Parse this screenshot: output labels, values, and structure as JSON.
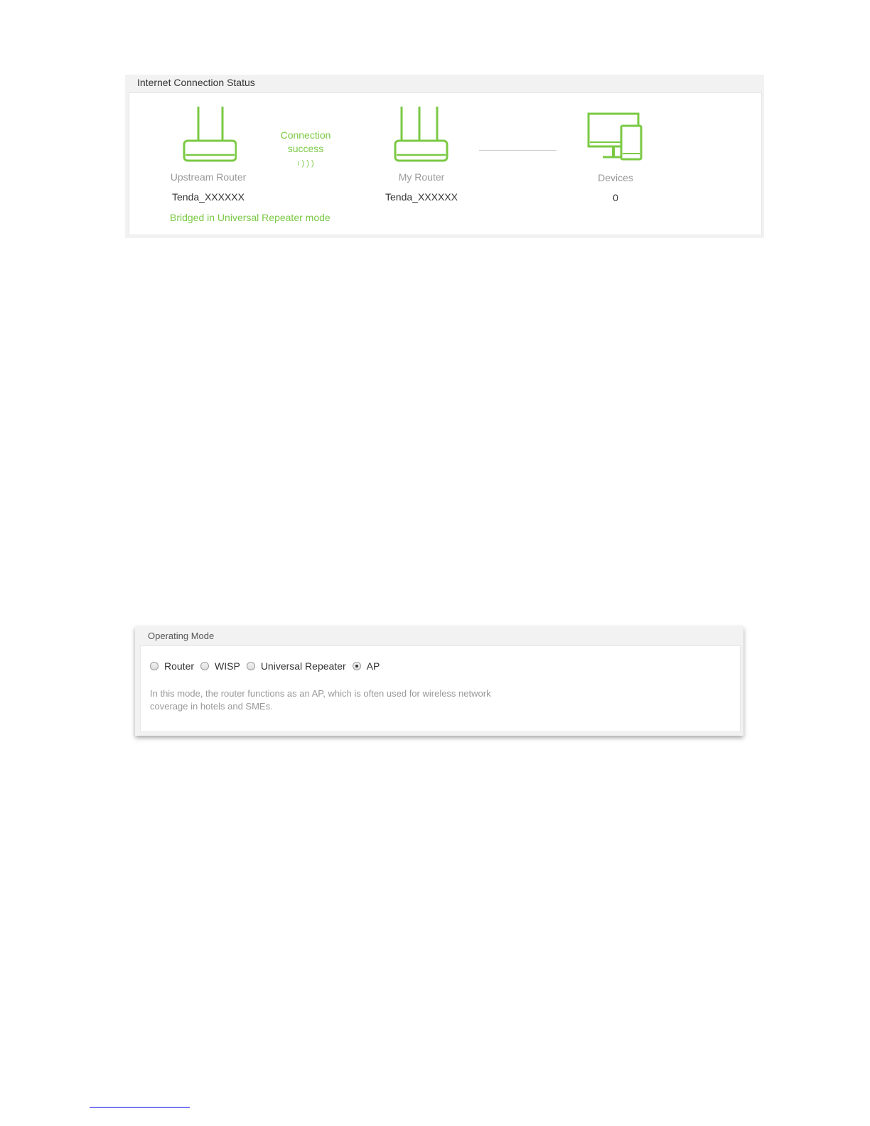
{
  "connection_status": {
    "title": "Internet Connection Status",
    "upstream_router": {
      "label": "Upstream Router",
      "name": "Tenda_XXXXXX",
      "mode_text": "Bridged in Universal Repeater mode"
    },
    "link": {
      "status_line1": "Connection",
      "status_line2": "success",
      "signal_glyph": "ı ) ) )"
    },
    "my_router": {
      "label": "My Router",
      "name": "Tenda_XXXXXX"
    },
    "devices": {
      "label": "Devices",
      "count": "0"
    },
    "colors": {
      "accent": "#7ac943",
      "label": "#999999",
      "text": "#333333"
    }
  },
  "operating_mode": {
    "title": "Operating Mode",
    "options": [
      {
        "label": "Router",
        "checked": false
      },
      {
        "label": "WISP",
        "checked": false
      },
      {
        "label": "Universal Repeater",
        "checked": false
      },
      {
        "label": "AP",
        "checked": true
      }
    ],
    "description_line1": "In this mode, the router functions as an AP, which is often used for wireless network",
    "description_line2": "coverage in hotels and SMEs."
  }
}
